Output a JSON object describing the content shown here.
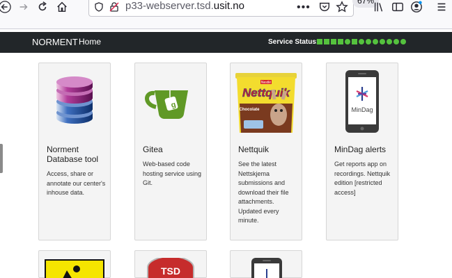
{
  "browser": {
    "url_prefix": "p33-webserver.tsd.",
    "url_domain": "usit.no",
    "zoom": "67%",
    "menu_dots": "•••"
  },
  "navbar": {
    "brand": "NORMENT",
    "home": "Home",
    "status_label": "Service Status:",
    "status_indicators": [
      "square",
      "square",
      "square",
      "square",
      "circle",
      "square",
      "circle",
      "circle",
      "circle",
      "circle",
      "circle",
      "circle",
      "circle"
    ],
    "status_color": "#55c23e"
  },
  "cards": [
    {
      "title": "Norment Database tool",
      "desc": "Access, share or annotate our center's inhouse data.",
      "icon": "database-icon"
    },
    {
      "title": "Gitea",
      "desc": "Web-based code hosting service using Git.",
      "icon": "gitea-logo"
    },
    {
      "title": "Nettquik",
      "desc": "See the latest Nettskjema submissions and download their file attachments. Updated every minute.",
      "icon": "nettquik-can-image",
      "logo_text": "Nettquik",
      "brand_tag": "Nestlé",
      "flavor": "Chocolate"
    },
    {
      "title": "MinDag alerts",
      "desc": "Get reports app on recordings. Nettquik edition [restricted access]",
      "icon": "mindag-phone-image",
      "app_name": "MinDag"
    }
  ],
  "bottom_cards": [
    {
      "icon": "warning-sign-image"
    },
    {
      "icon": "tsd-shield-image",
      "text": "TSD"
    },
    {
      "icon": "phone-image"
    }
  ]
}
